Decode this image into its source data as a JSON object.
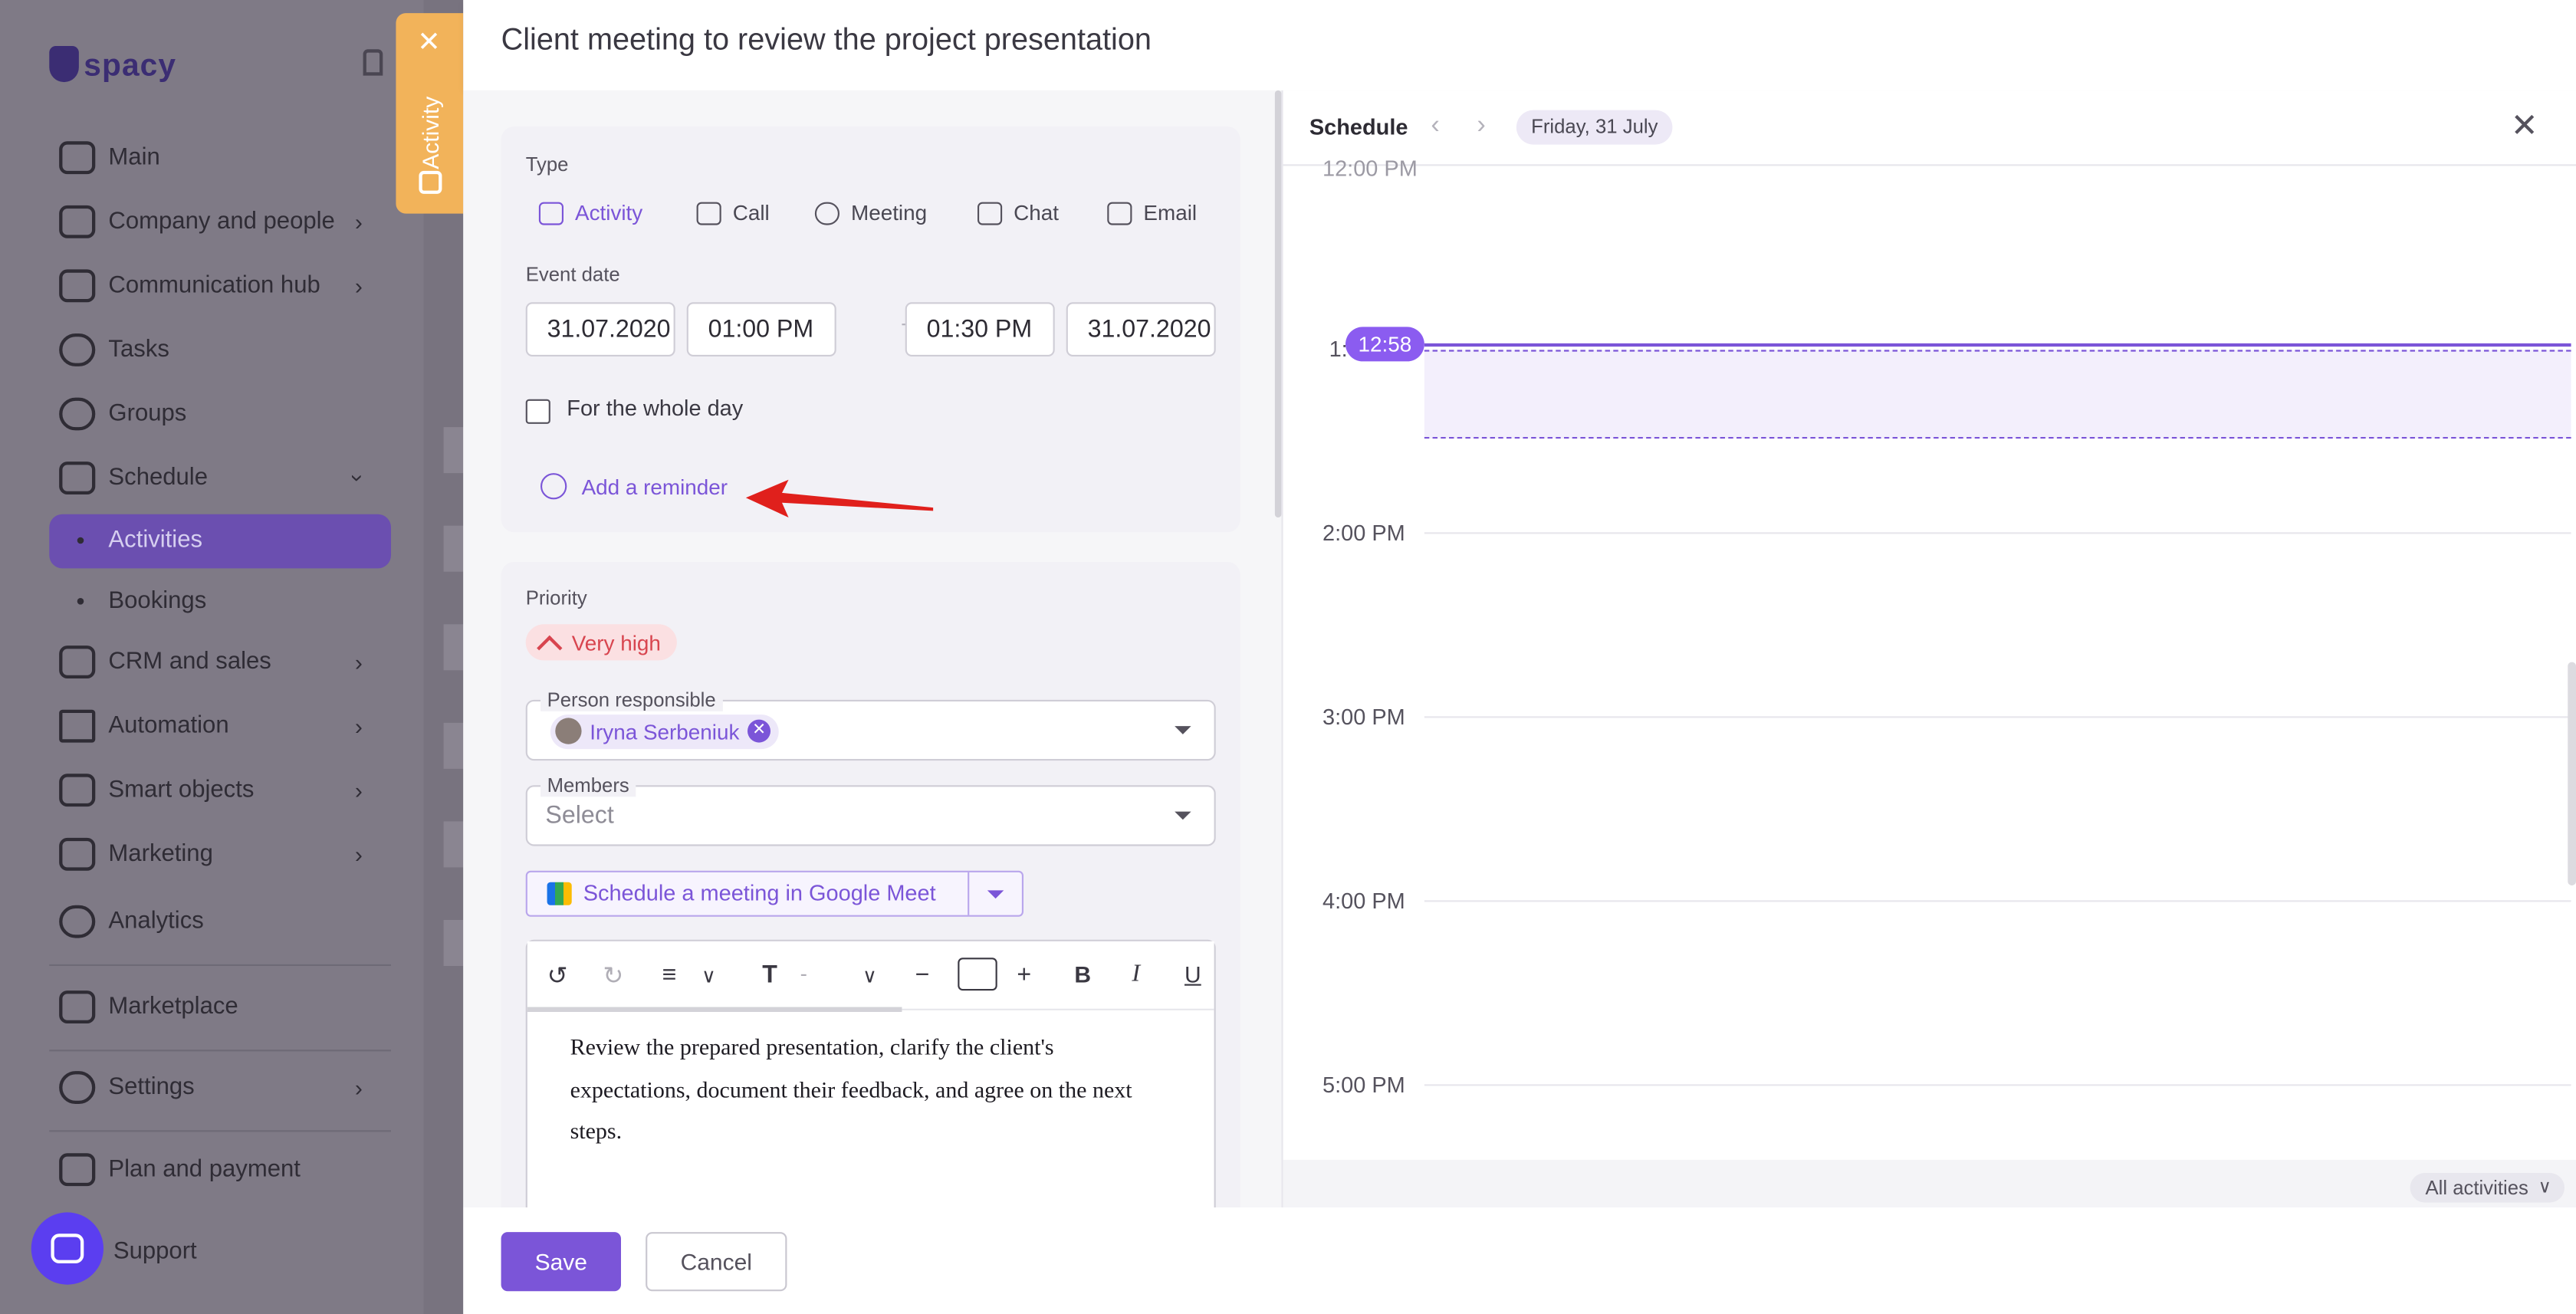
{
  "sidebar": {
    "logo": "spacy",
    "items": [
      {
        "label": "Main"
      },
      {
        "label": "Company and people"
      },
      {
        "label": "Communication hub"
      },
      {
        "label": "Tasks"
      },
      {
        "label": "Groups"
      },
      {
        "label": "Schedule"
      },
      {
        "label": "CRM and sales"
      },
      {
        "label": "Automation"
      },
      {
        "label": "Smart objects"
      },
      {
        "label": "Marketing"
      },
      {
        "label": "Analytics"
      },
      {
        "label": "Marketplace"
      },
      {
        "label": "Settings"
      },
      {
        "label": "Plan and payment"
      },
      {
        "label": "Support"
      }
    ],
    "sub_items": [
      {
        "label": "Activities",
        "active": true
      },
      {
        "label": "Bookings",
        "active": false
      }
    ]
  },
  "side_tab": {
    "label": "Activity"
  },
  "drawer": {
    "title": "Client meeting to review the project presentation",
    "type_label": "Type",
    "types": [
      {
        "label": "Activity",
        "icon": "calendar-icon",
        "active": true
      },
      {
        "label": "Call",
        "icon": "phone-icon",
        "active": false
      },
      {
        "label": "Meeting",
        "icon": "people-icon",
        "active": false
      },
      {
        "label": "Chat",
        "icon": "chat-icon",
        "active": false
      },
      {
        "label": "Email",
        "icon": "email-icon",
        "active": false
      }
    ],
    "event_date_label": "Event date",
    "start_date": "31.07.2020",
    "start_time": "01:00 PM",
    "end_time": "01:30 PM",
    "end_date": "31.07.2020",
    "whole_day_label": "For the whole day",
    "add_reminder_label": "Add a reminder",
    "priority_label": "Priority",
    "priority_value": "Very high",
    "person_responsible_label": "Person responsible",
    "person_responsible_value": "Iryna Serbeniuk",
    "members_label": "Members",
    "members_placeholder": "Select",
    "google_meet_label": "Schedule a meeting in Google Meet",
    "editor": {
      "font_size": "-",
      "text": "Review the prepared presentation, clarify the client's expectations, document their feedback, and agree on the next steps."
    },
    "save_label": "Save",
    "cancel_label": "Cancel"
  },
  "schedule": {
    "title": "Schedule",
    "date": "Friday, 31 July",
    "current_time": "12:58",
    "time_labels": [
      "12:00 PM",
      "1:",
      "2:00 PM",
      "3:00 PM",
      "4:00 PM",
      "5:00 PM"
    ],
    "filter_label": "All activities"
  },
  "colors": {
    "accent": "#7b55d8",
    "tab_orange": "#f2b35a",
    "priority_red": "#d8454f"
  }
}
